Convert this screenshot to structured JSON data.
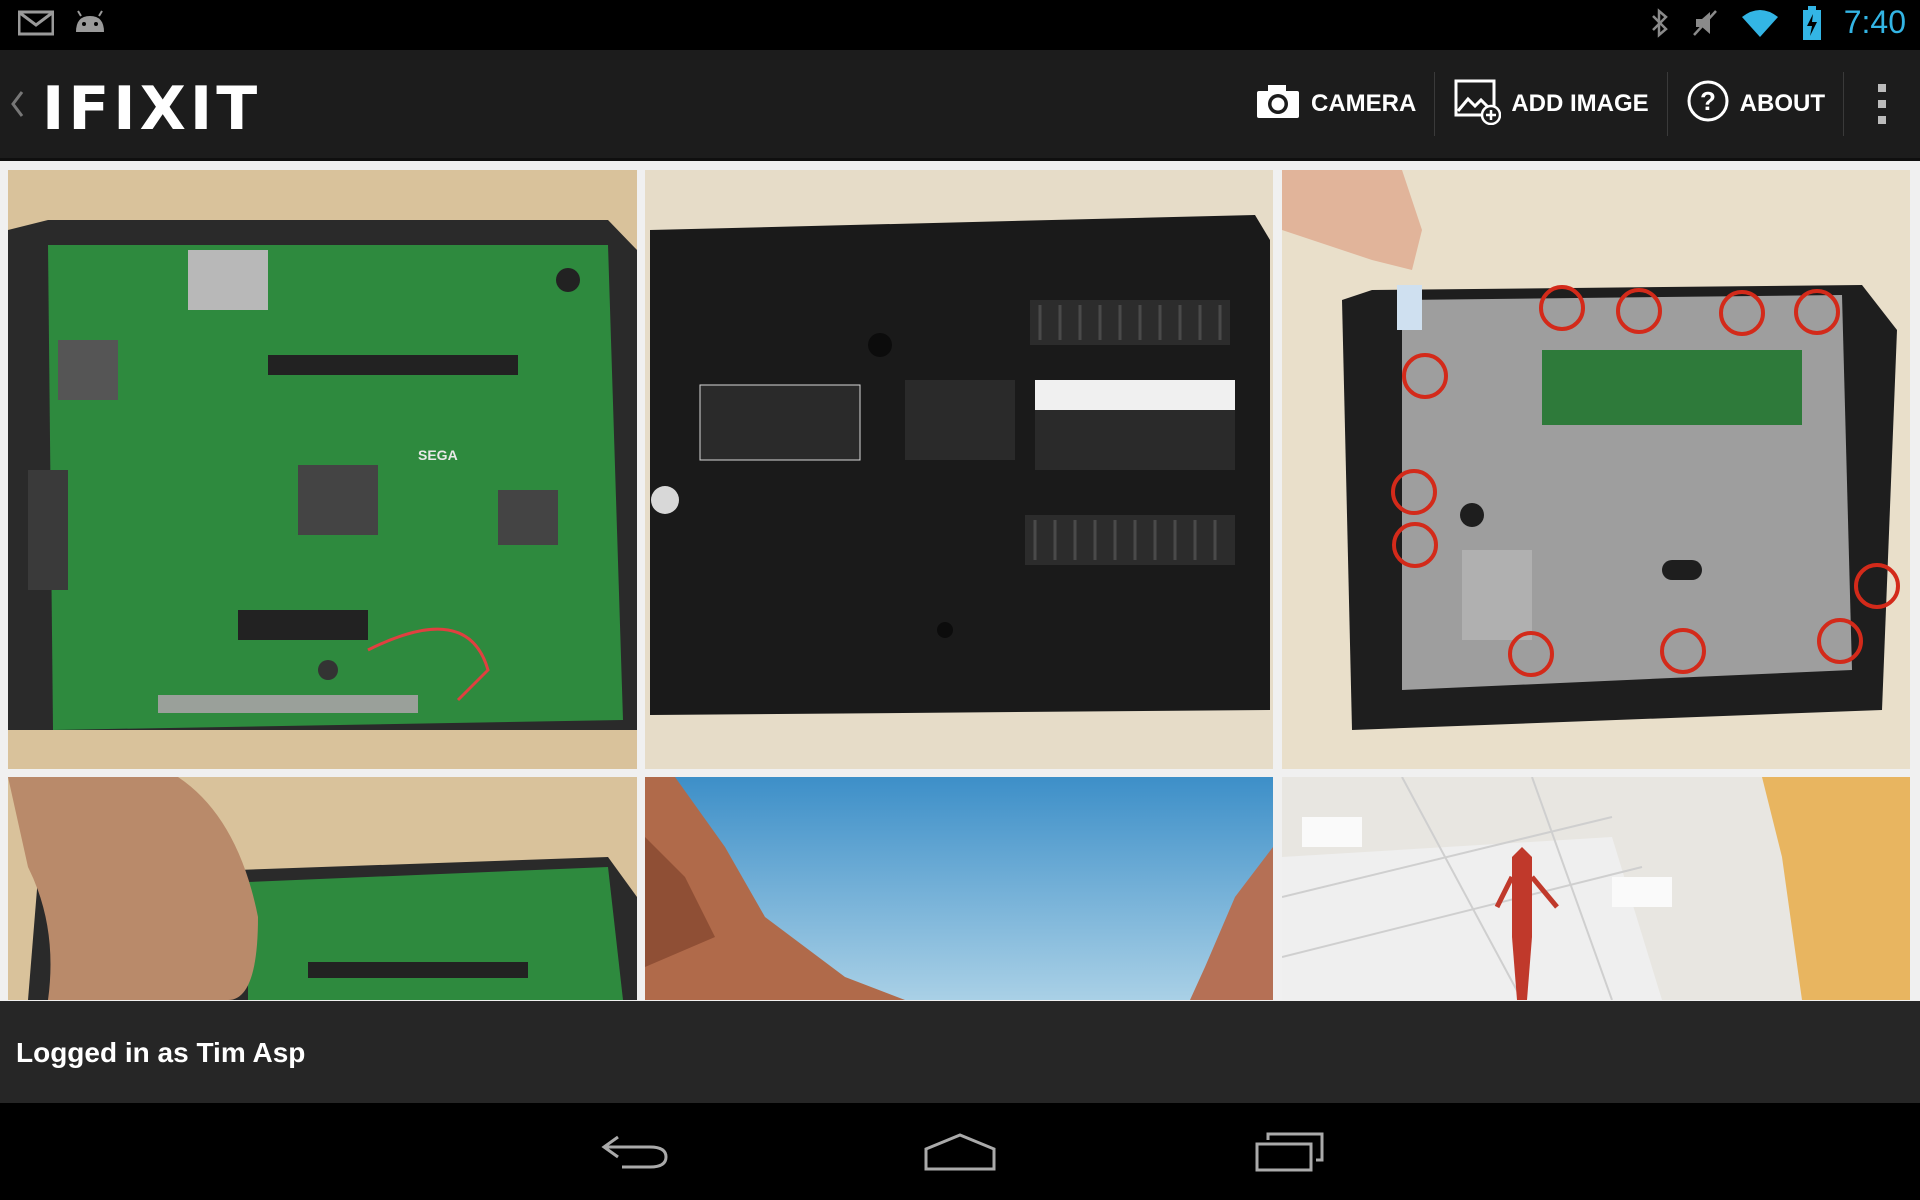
{
  "status_bar": {
    "left_icons": [
      "gmail-icon",
      "android-debug-icon"
    ],
    "right_icons": [
      "bluetooth-icon",
      "mute-icon",
      "wifi-icon",
      "battery-charging-icon"
    ],
    "time": "7:40",
    "accent_color": "#33b5e5"
  },
  "action_bar": {
    "logo_text": "IFIXIT",
    "actions": [
      {
        "label": "CAMERA",
        "icon": "camera-icon"
      },
      {
        "label": "ADD IMAGE",
        "icon": "add-image-icon"
      },
      {
        "label": "ABOUT",
        "icon": "help-circle-icon"
      }
    ],
    "overflow_icon": "overflow-menu-icon"
  },
  "gallery": {
    "images": [
      {
        "description": "green circuit board"
      },
      {
        "description": "black console bottom case"
      },
      {
        "description": "console with screws circled in red"
      },
      {
        "description": "hand on circuit board"
      },
      {
        "description": "canyon and blue sky"
      },
      {
        "description": "ceiling with figure"
      }
    ]
  },
  "footer": {
    "login_text": "Logged in as Tim Asp"
  },
  "nav_bar": {
    "buttons": [
      "back-icon",
      "home-icon",
      "recents-icon"
    ]
  }
}
